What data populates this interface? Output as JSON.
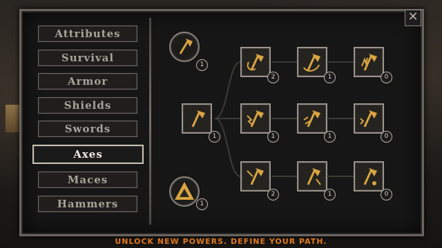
{
  "menu": {
    "categories": [
      {
        "label": "Attributes"
      },
      {
        "label": "Survival"
      },
      {
        "label": "Armor"
      },
      {
        "label": "Shields"
      },
      {
        "label": "Swords"
      },
      {
        "label": "Axes"
      },
      {
        "label": "Maces"
      },
      {
        "label": "Hammers"
      }
    ],
    "selected": "Axes"
  },
  "close_icon": "close-icon",
  "tree": {
    "header_axe": {
      "icon": "axe-icon",
      "level": "1"
    },
    "header_rank": {
      "icon": "triangle-rank-icon",
      "level": "1"
    },
    "root": {
      "icon": "axe-icon",
      "level": "1"
    },
    "row1": [
      {
        "icon": "axe-hook-icon",
        "level": "2"
      },
      {
        "icon": "axe-crescent-icon",
        "level": "1"
      },
      {
        "icon": "axe-flame-icon",
        "level": "0"
      }
    ],
    "row2": [
      {
        "icon": "axe-lightning-icon",
        "level": "1"
      },
      {
        "icon": "axe-spark-icon",
        "level": "1"
      },
      {
        "icon": "axe-burst-icon",
        "level": "0"
      }
    ],
    "row3": [
      {
        "icon": "axe-cross-icon",
        "level": "2"
      },
      {
        "icon": "axe-strike-icon",
        "level": "1"
      },
      {
        "icon": "axe-drop-icon",
        "level": "0"
      }
    ]
  },
  "tagline": "UNLOCK NEW POWERS. DEFINE YOUR PATH.",
  "colors": {
    "accent": "#e07a1f",
    "icon_gold": "#d9a441",
    "frame": "#9a948c"
  }
}
